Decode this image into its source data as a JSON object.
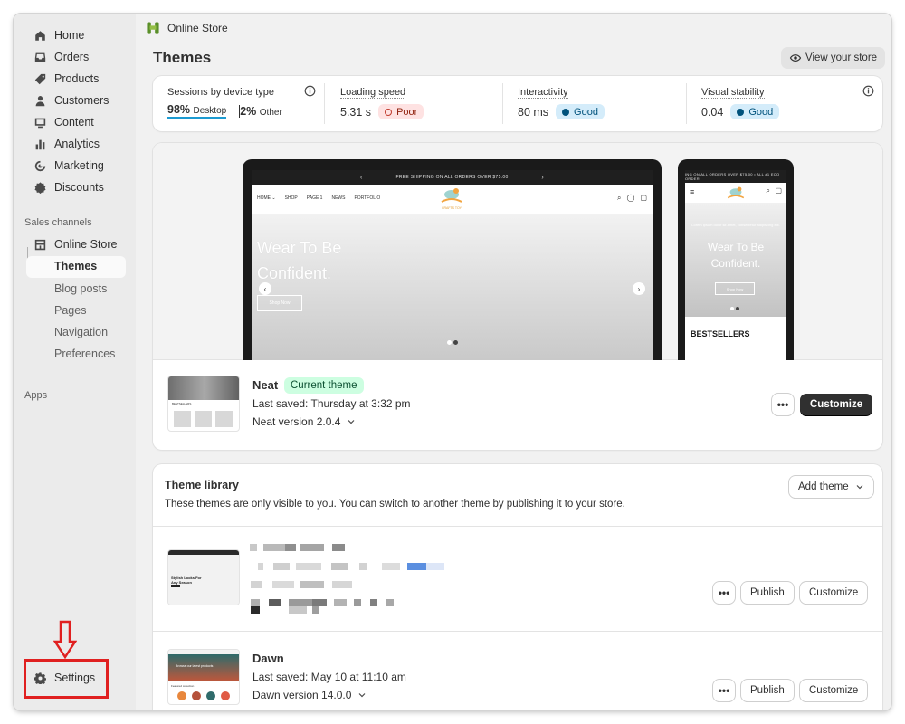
{
  "sidebar": {
    "nav": [
      {
        "label": "Home",
        "icon": "home-icon"
      },
      {
        "label": "Orders",
        "icon": "inbox-icon"
      },
      {
        "label": "Products",
        "icon": "tag-icon"
      },
      {
        "label": "Customers",
        "icon": "person-icon"
      },
      {
        "label": "Content",
        "icon": "image-icon"
      },
      {
        "label": "Analytics",
        "icon": "bar-chart-icon"
      },
      {
        "label": "Marketing",
        "icon": "target-icon"
      },
      {
        "label": "Discounts",
        "icon": "discount-icon"
      }
    ],
    "sales_channels_label": "Sales channels",
    "online_store_label": "Online Store",
    "sub_items": [
      "Themes",
      "Blog posts",
      "Pages",
      "Navigation",
      "Preferences"
    ],
    "apps_label": "Apps",
    "settings_label": "Settings"
  },
  "breadcrumb": {
    "label": "Online Store"
  },
  "page": {
    "title": "Themes",
    "view_store_label": "View your store"
  },
  "metrics": {
    "sessions_label": "Sessions by device type",
    "desktop_pct": "98%",
    "desktop_label": "Desktop",
    "other_pct": "2%",
    "other_label": "Other",
    "loading_label": "Loading speed",
    "loading_value": "5.31 s",
    "loading_status": "Poor",
    "interactivity_label": "Interactivity",
    "interactivity_value": "80 ms",
    "interactivity_status": "Good",
    "stability_label": "Visual stability",
    "stability_value": "0.04",
    "stability_status": "Good"
  },
  "preview": {
    "announcement": "FREE SHIPPING ON ALL ORDERS OVER $75.00",
    "phone_announcement": "ING ON ALL ORDERS OVER $75.00  •  ALL #1 ECO ORDER",
    "nav_links": [
      "HOME ⌄",
      "SHOP",
      "PAGE 1",
      "NEWS",
      "PORTFOLIO"
    ],
    "logo_text": "CRAFTS TOY",
    "hero_line1": "Wear To Be",
    "hero_line2": "Confident.",
    "shop_now": "Shop Now",
    "phone_sub": "Lorem ipsum dolor sit amet, consectetur adipiscing elit.",
    "bestsellers": "BESTSELLERS",
    "thumb_section": "BESTSELLERS"
  },
  "current_theme": {
    "name": "Neat",
    "badge": "Current theme",
    "last_saved": "Last saved: Thursday at 3:32 pm",
    "version": "Neat version 2.0.4",
    "customize_label": "Customize",
    "more_label": "•••"
  },
  "library": {
    "title": "Theme library",
    "description": "These themes are only visible to you. You can switch to another theme by publishing it to your store.",
    "add_theme_label": "Add theme",
    "items": [
      {
        "thumb_text": "Stylish Looks For Any Season",
        "publish_label": "Publish",
        "customize_label": "Customize",
        "more_label": "•••"
      },
      {
        "name": "Dawn",
        "last_saved": "Last saved: May 10 at 11:10 am",
        "version": "Dawn version 14.0.0",
        "thumb_text": "Browse our latest products",
        "thumb_section": "Featured collection",
        "publish_label": "Publish",
        "customize_label": "Customize",
        "more_label": "•••"
      }
    ]
  },
  "colors": {
    "annotation": "#e02020",
    "good": "#00527c",
    "poor": "#8e1f0b",
    "current_badge": "#cdfee1"
  }
}
